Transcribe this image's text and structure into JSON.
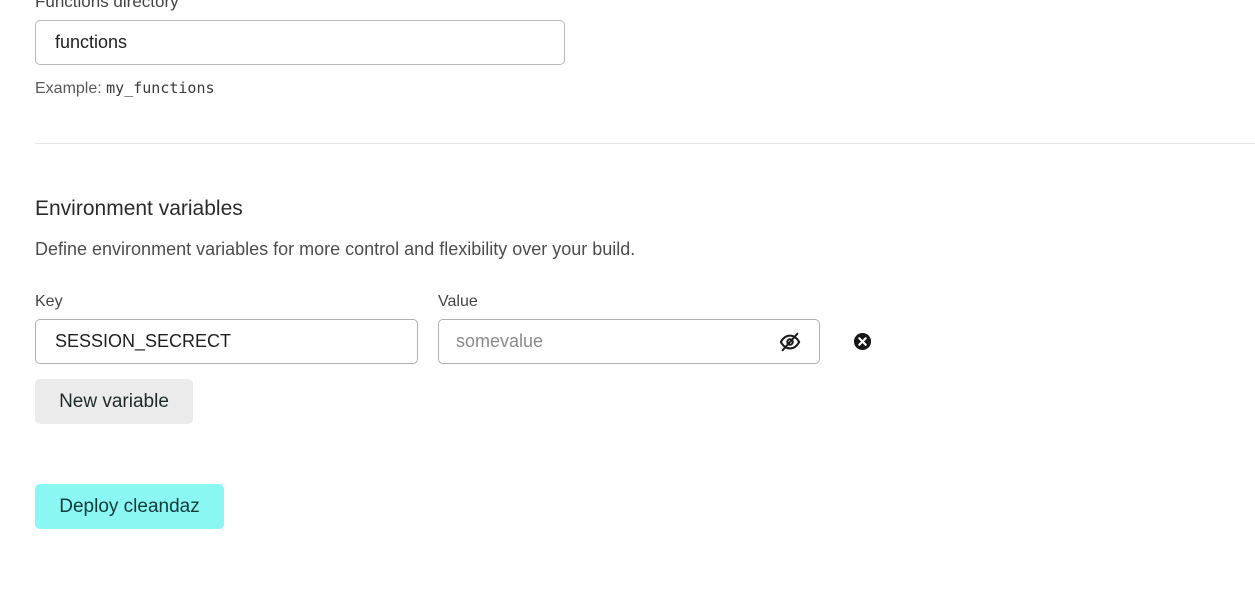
{
  "functions": {
    "label": "Functions directory",
    "value": "functions",
    "example_prefix": "Example: ",
    "example_code": "my_functions"
  },
  "env": {
    "title": "Environment variables",
    "description": "Define environment variables for more control and flexibility over your build.",
    "key_label": "Key",
    "value_label": "Value",
    "rows": [
      {
        "key": "SESSION_SECRECT",
        "value_placeholder": "somevalue",
        "visibility_icon": "eye-off-icon",
        "remove_icon": "close-circle-icon"
      }
    ],
    "new_variable_label": "New variable"
  },
  "deploy": {
    "label": "Deploy cleandaz",
    "color": "#8bf7f3"
  }
}
